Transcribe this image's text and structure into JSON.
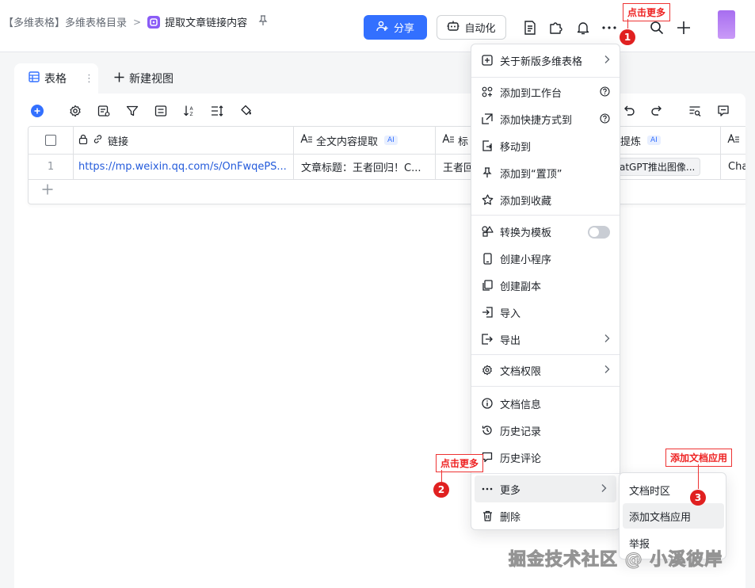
{
  "breadcrumb": {
    "parent": "【多维表格】多维表格目录",
    "separator": ">",
    "current": "提取文章链接内容"
  },
  "header": {
    "share_label": "分享",
    "automation_label": "自动化"
  },
  "view_tabs": {
    "active_label": "表格",
    "active_more": "⋮",
    "new_view_label": "新建视图"
  },
  "grid": {
    "columns": [
      {
        "label": "链接"
      },
      {
        "label": "全文内容提取",
        "badge": "AI"
      },
      {
        "label": "标"
      },
      {
        "label": "提炼",
        "badge": "AI"
      },
      {
        "label": ""
      }
    ],
    "rows": [
      {
        "index": "1",
        "link": "https://mp.weixin.qq.com/s/OnFwqePS...",
        "content": "文章标题：王者回归！C...",
        "title": "王者回",
        "summary": "atGPT推出图像...",
        "extra": "Cha"
      }
    ]
  },
  "menu": {
    "items": [
      {
        "id": "about",
        "label": "关于新版多维表格",
        "icon": "info-square-icon",
        "arrow": true
      },
      {
        "id": "workspace",
        "label": "添加到工作台",
        "icon": "apps-icon",
        "help": true
      },
      {
        "id": "shortcut",
        "label": "添加快捷方式到",
        "icon": "shortcut-icon",
        "help": true
      },
      {
        "id": "move",
        "label": "移动到",
        "icon": "move-icon"
      },
      {
        "id": "pin",
        "label": "添加到“置顶”",
        "icon": "pin-icon"
      },
      {
        "id": "favorite",
        "label": "添加到收藏",
        "icon": "star-icon"
      },
      {
        "id": "template",
        "label": "转换为模板",
        "icon": "template-icon",
        "toggle": false
      },
      {
        "id": "miniprogram",
        "label": "创建小程序",
        "icon": "phone-icon"
      },
      {
        "id": "copy",
        "label": "创建副本",
        "icon": "copy-icon"
      },
      {
        "id": "import",
        "label": "导入",
        "icon": "import-icon"
      },
      {
        "id": "export",
        "label": "导出",
        "icon": "export-icon",
        "arrow": true
      },
      {
        "id": "permission",
        "label": "文档权限",
        "icon": "gear-icon",
        "arrow": true
      },
      {
        "id": "info",
        "label": "文档信息",
        "icon": "info-icon"
      },
      {
        "id": "history",
        "label": "历史记录",
        "icon": "history-icon"
      },
      {
        "id": "comments",
        "label": "历史评论",
        "icon": "comment-icon"
      },
      {
        "id": "more",
        "label": "更多",
        "icon": "more-icon",
        "arrow": true
      },
      {
        "id": "delete",
        "label": "删除",
        "icon": "trash-icon"
      }
    ]
  },
  "submenu": {
    "items": [
      {
        "label": "文档时区"
      },
      {
        "label": "添加文档应用"
      },
      {
        "label": "举报"
      }
    ]
  },
  "annotations": {
    "a1": {
      "text": "点击更多",
      "num": "1"
    },
    "a2": {
      "text": "点击更多",
      "num": "2"
    },
    "a3": {
      "text": "添加文档应用",
      "num": "3"
    }
  },
  "watermark": "掘金技术社区 @ 小溪彼岸",
  "colors": {
    "accent": "#3370ff",
    "annotation_red": "#e02020",
    "link": "#245bdb"
  }
}
